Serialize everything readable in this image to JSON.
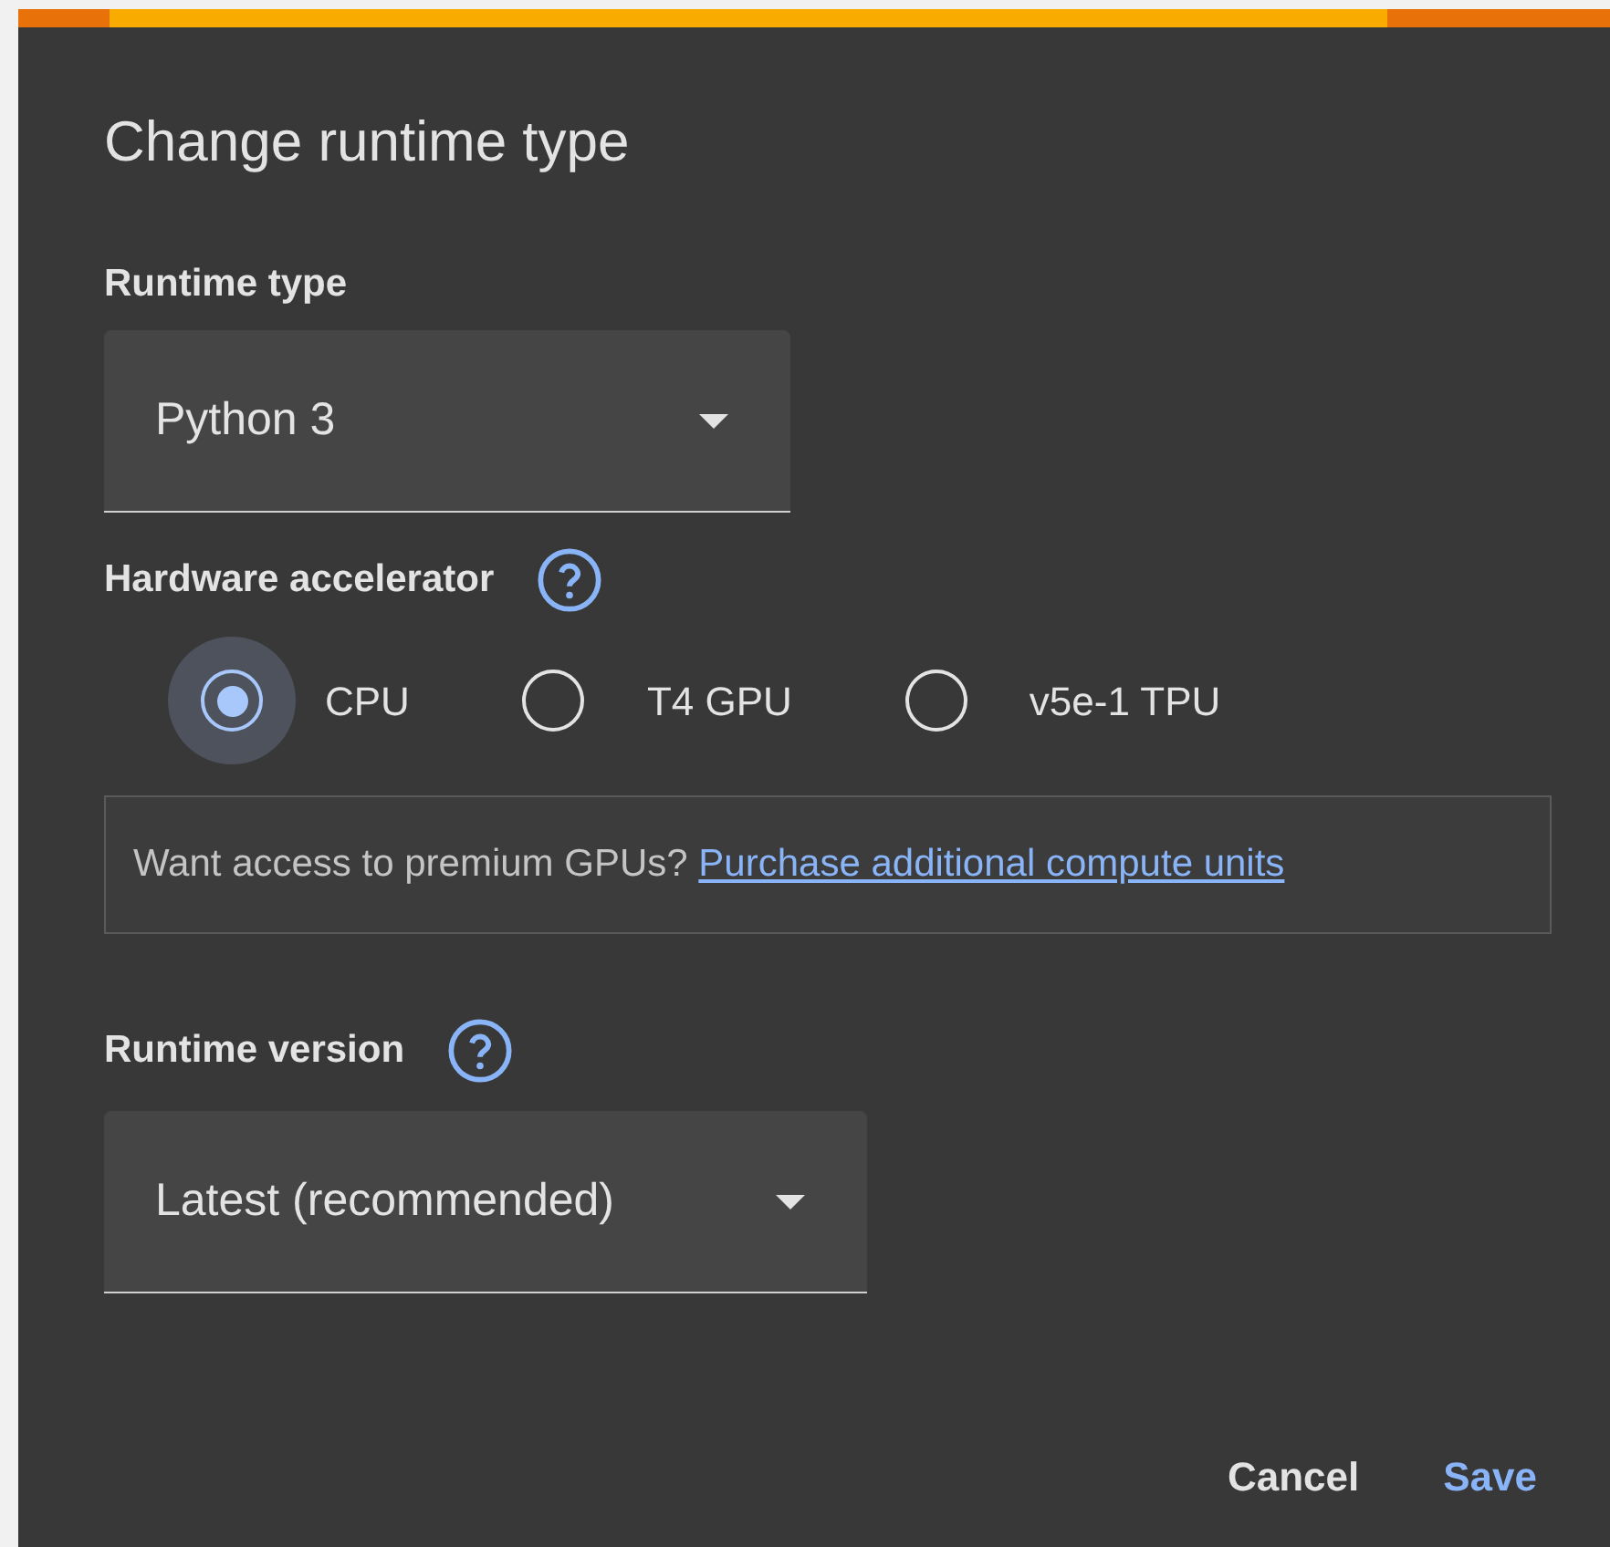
{
  "dialog": {
    "title": "Change runtime type"
  },
  "runtime_type": {
    "label": "Runtime type",
    "value": "Python 3"
  },
  "hardware_accelerator": {
    "label": "Hardware accelerator",
    "options": [
      {
        "label": "CPU",
        "selected": true
      },
      {
        "label": "T4 GPU",
        "selected": false
      },
      {
        "label": "v5e-1 TPU",
        "selected": false
      }
    ]
  },
  "notice": {
    "text": "Want access to premium GPUs?",
    "link": "Purchase additional compute units"
  },
  "runtime_version": {
    "label": "Runtime version",
    "value": "Latest (recommended)"
  },
  "buttons": [
    {
      "label": "Cancel",
      "kind": "secondary"
    },
    {
      "label": "Save",
      "kind": "primary"
    }
  ]
}
